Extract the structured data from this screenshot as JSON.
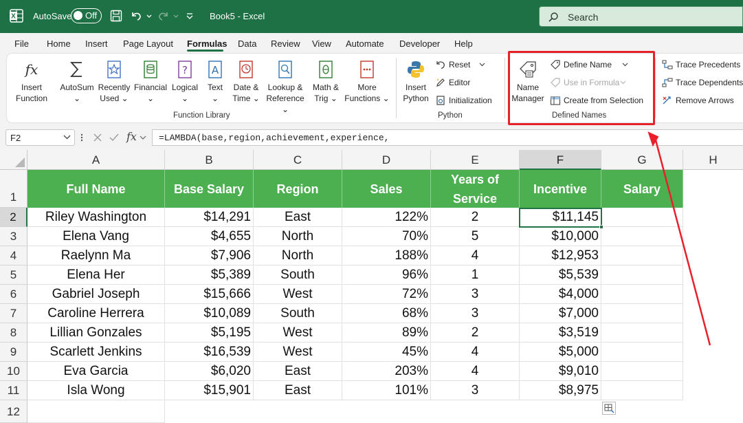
{
  "titlebar": {
    "autosave_label": "AutoSave",
    "autosave_state": "Off",
    "document_title": "Book5  -  Excel",
    "search_placeholder": "Search"
  },
  "menu": {
    "tabs": [
      "File",
      "Home",
      "Insert",
      "Page Layout",
      "Formulas",
      "Data",
      "Review",
      "View",
      "Automate",
      "Developer",
      "Help"
    ],
    "active_tab": "Formulas"
  },
  "ribbon": {
    "function_library": {
      "group_label": "Function Library",
      "insert_function": [
        "Insert",
        "Function"
      ],
      "autosum": [
        "AutoSum",
        "⌄"
      ],
      "recently_used": [
        "Recently",
        "Used ⌄"
      ],
      "financial": [
        "Financial",
        "⌄"
      ],
      "logical": [
        "Logical",
        "⌄"
      ],
      "text": [
        "Text",
        "⌄"
      ],
      "date_time": [
        "Date &",
        "Time ⌄"
      ],
      "lookup_reference": [
        "Lookup &",
        "Reference ⌄"
      ],
      "math_trig": [
        "Math &",
        "Trig ⌄"
      ],
      "more_functions": [
        "More",
        "Functions ⌄"
      ]
    },
    "python": {
      "group_label": "Python",
      "insert_python": [
        "Insert",
        "Python"
      ],
      "reset": "Reset",
      "editor": "Editor",
      "initialization": "Initialization"
    },
    "defined_names": {
      "group_label": "Defined Names",
      "name_manager": [
        "Name",
        "Manager"
      ],
      "define_name": "Define Name",
      "use_in_formula": "Use in Formula",
      "create_from_selection": "Create from Selection"
    },
    "formula_auditing": {
      "trace_precedents": "Trace Precedents",
      "trace_dependents": "Trace Dependents",
      "remove_arrows": "Remove Arrows"
    }
  },
  "formula_bar": {
    "name_box": "F2",
    "fx_label": "fx",
    "formula": "=LAMBDA(base,region,achievement,experience,"
  },
  "sheet": {
    "columns": [
      "A",
      "B",
      "C",
      "D",
      "E",
      "F",
      "G",
      "H"
    ],
    "selected_column": "F",
    "rows": [
      "1",
      "2",
      "3",
      "4",
      "5",
      "6",
      "7",
      "8",
      "9",
      "10",
      "11",
      "12"
    ],
    "selected_row": "2",
    "headers": [
      "Full Name",
      "Base Salary",
      "Region",
      "Sales",
      "Years of Service",
      "Incentive",
      "Salary"
    ],
    "data": [
      [
        "Riley Washington",
        "$14,291",
        "East",
        "122%",
        "2",
        "$11,145",
        ""
      ],
      [
        "Elena Vang",
        "$4,655",
        "North",
        "70%",
        "5",
        "$10,000",
        ""
      ],
      [
        "Raelynn Ma",
        "$7,906",
        "North",
        "188%",
        "4",
        "$12,953",
        ""
      ],
      [
        "Elena Her",
        "$5,389",
        "South",
        "96%",
        "1",
        "$5,539",
        ""
      ],
      [
        "Gabriel Joseph",
        "$15,666",
        "West",
        "72%",
        "3",
        "$4,000",
        ""
      ],
      [
        "Caroline Herrera",
        "$10,089",
        "South",
        "68%",
        "3",
        "$7,000",
        ""
      ],
      [
        "Lillian Gonzales",
        "$5,195",
        "West",
        "89%",
        "2",
        "$3,519",
        ""
      ],
      [
        "Scarlett Jenkins",
        "$16,539",
        "West",
        "45%",
        "4",
        "$5,000",
        ""
      ],
      [
        "Eva Garcia",
        "$6,020",
        "East",
        "203%",
        "4",
        "$9,010",
        ""
      ],
      [
        "Isla Wong",
        "$15,901",
        "East",
        "101%",
        "3",
        "$8,975",
        ""
      ]
    ]
  },
  "colors": {
    "excel_green": "#1e7145",
    "header_fill": "#4caf50",
    "annotation_red": "#e8202a"
  }
}
